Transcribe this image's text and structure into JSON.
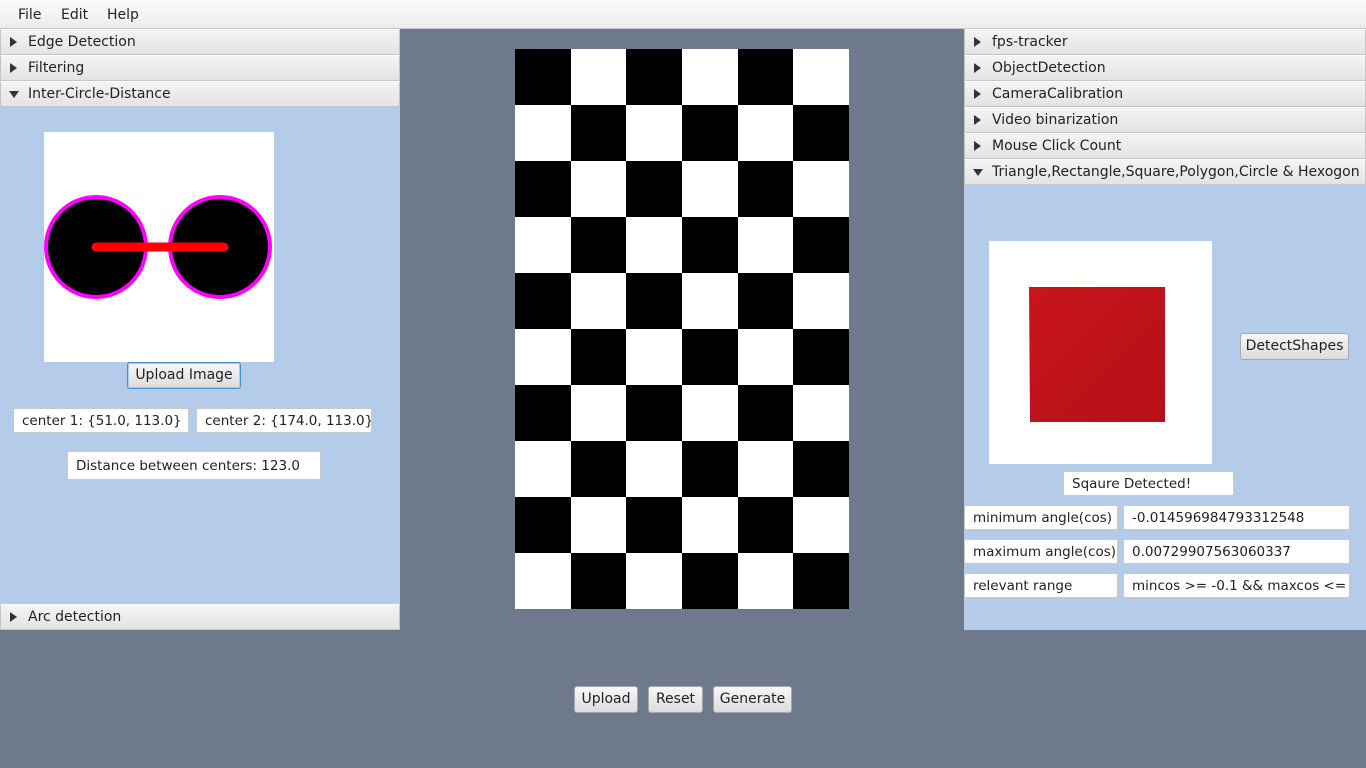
{
  "menu": [
    "File",
    "Edit",
    "Help"
  ],
  "left_panel": {
    "sections": [
      {
        "label": "Edge Detection",
        "expanded": false
      },
      {
        "label": "Filtering",
        "expanded": false
      },
      {
        "label": "Inter-Circle-Distance",
        "expanded": true
      },
      {
        "label": "Arc detection",
        "expanded": false
      }
    ],
    "upload_button": "Upload Image",
    "center1": "center 1: {51.0, 113.0}",
    "center2": "center 2: {174.0, 113.0}",
    "distance": "Distance between centers: 123.0",
    "circle_color": "#ff00ff",
    "line_color": "#ff0000"
  },
  "center": {
    "checkerboard": {
      "columns": 6,
      "rows": 10
    },
    "buttons": {
      "upload": "Upload",
      "reset": "Reset",
      "generate": "Generate"
    }
  },
  "right_panel": {
    "sections": [
      {
        "label": "fps-tracker",
        "expanded": false
      },
      {
        "label": "ObjectDetection",
        "expanded": false
      },
      {
        "label": "CameraCalibration",
        "expanded": false
      },
      {
        "label": "Video binarization",
        "expanded": false
      },
      {
        "label": "Mouse Click Count",
        "expanded": false
      },
      {
        "label": "Triangle,Rectangle,Square,Polygon,Circle & Hexogon",
        "expanded": true
      }
    ],
    "detect_button": "DetectShapes",
    "result": "Sqaure Detected!",
    "min_label": "minimum angle(cos)",
    "min_value": "-0.014596984793312548",
    "max_label": "maximum angle(cos)",
    "max_value": "0.00729907563060337",
    "range_label": "relevant range",
    "range_value": "mincos >= -0.1 && maxcos <=",
    "square_color": "#c0141c"
  },
  "colors": {
    "background": "#6e7a8b",
    "pane": "#b5cbea"
  }
}
